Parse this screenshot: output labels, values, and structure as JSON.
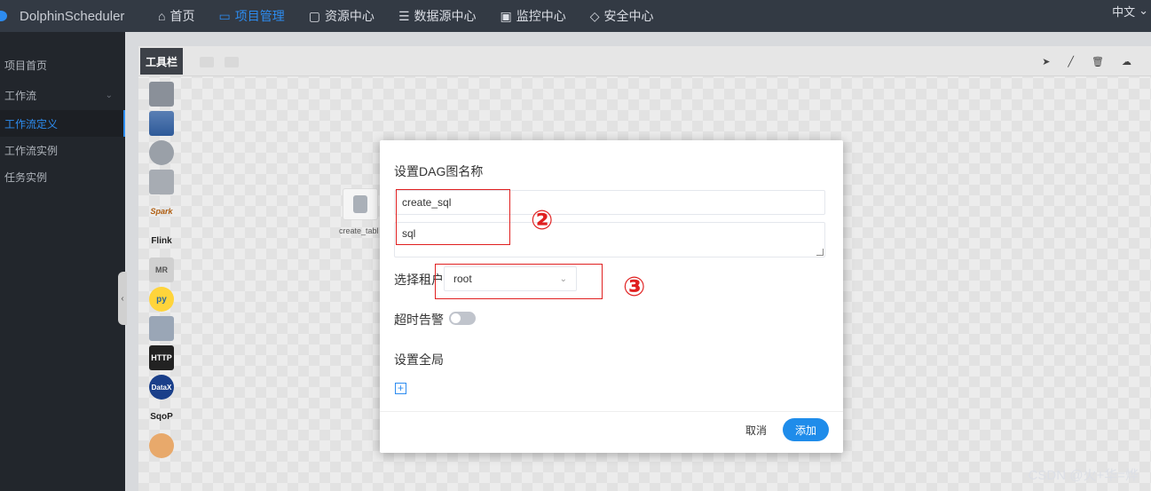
{
  "app": {
    "brand": "DolphinScheduler"
  },
  "nav": {
    "items": [
      {
        "icon": "home-icon",
        "label": "首页"
      },
      {
        "icon": "project-icon",
        "label": "项目管理"
      },
      {
        "icon": "folder-icon",
        "label": "资源中心"
      },
      {
        "icon": "database-icon",
        "label": "数据源中心"
      },
      {
        "icon": "monitor-icon",
        "label": "监控中心"
      },
      {
        "icon": "shield-icon",
        "label": "安全中心"
      }
    ],
    "active_index": 1,
    "language": "中文"
  },
  "sidebar": {
    "items": [
      {
        "label": "项目首页"
      },
      {
        "label": "工作流"
      },
      {
        "label": "工作流定义"
      },
      {
        "label": "工作流实例"
      },
      {
        "label": "任务实例"
      }
    ]
  },
  "toolbar": {
    "label": "工具栏",
    "tools": [
      "shell",
      "sub-process",
      "procedure",
      "sql",
      "spark",
      "flink",
      "mr",
      "python",
      "dependent",
      "http",
      "datax",
      "sqoop",
      "conditions"
    ],
    "tool_texts": {
      "spark": "Spark",
      "flink": "Flink",
      "mr": "MR",
      "python": "py",
      "http": "HTTP",
      "datax": "DataX",
      "sqoop": "SqoP"
    }
  },
  "canvas": {
    "node_label": "create_tabl"
  },
  "modal": {
    "title": "设置DAG图名称",
    "name_value": "create_sql",
    "description_value": "sql",
    "tenant_label": "选择租户",
    "tenant_value": "root",
    "timeout_label": "超时告警",
    "timeout_enabled": false,
    "global_label": "设置全局",
    "cancel_label": "取消",
    "add_label": "添加"
  },
  "annotations": {
    "marker2": "②",
    "marker3": "③",
    "color": "#e02020"
  },
  "watermark": "CSDN @火+华=烨",
  "colors": {
    "accent": "#2d8cf0",
    "primary_button": "#1f8cea",
    "topbar": "#333a44",
    "sidebar": "#22262c"
  }
}
